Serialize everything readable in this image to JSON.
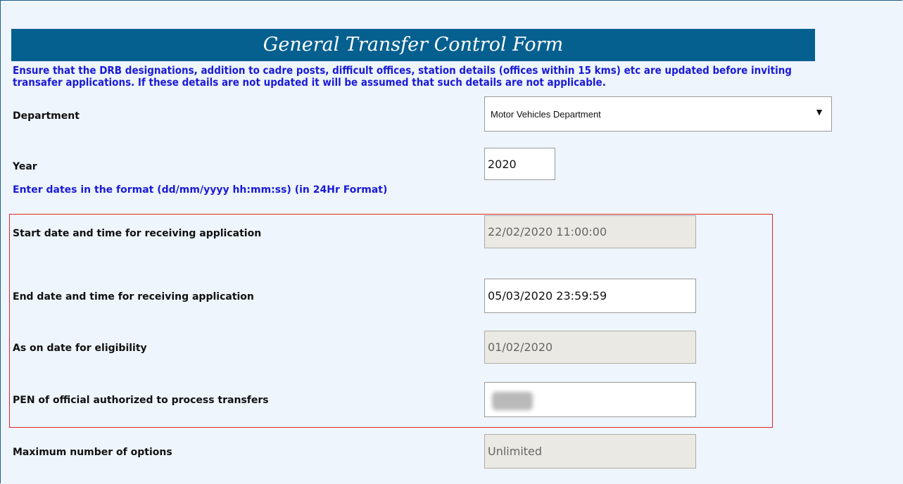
{
  "form": {
    "title": "General Transfer Control Form",
    "notice": "Ensure that the DRB designations, addition to cadre posts, difficult offices, station details (offices within 15 kms) etc are updated before inviting transafer applications. If these details are not updated it will be assumed that such details are not applicable.",
    "department_label": "Department",
    "department_value": "Motor Vehicles Department",
    "year_label": "Year",
    "year_value": "2020",
    "date_hint": "Enter dates in the format (dd/mm/yyyy hh:mm:ss) (in 24Hr Format)",
    "start_label": "Start date and time for receiving application",
    "start_value": "22/02/2020 11:00:00",
    "end_label": "End date and time for receiving application",
    "end_value": "05/03/2020 23:59:59",
    "as_on_label": "As on date for eligibility",
    "as_on_value": "01/02/2020",
    "pen_label": "PEN of official authorized to process transfers",
    "pen_value": "",
    "max_options_label": "Maximum number of options",
    "max_options_value": "Unlimited"
  },
  "colors": {
    "title_bar": "#06608f",
    "notice_text": "#1a1ad6",
    "highlight_border": "#e0242a",
    "page_background": "#eef5fc"
  },
  "icons": {
    "dropdown": "chevron-down-icon"
  }
}
